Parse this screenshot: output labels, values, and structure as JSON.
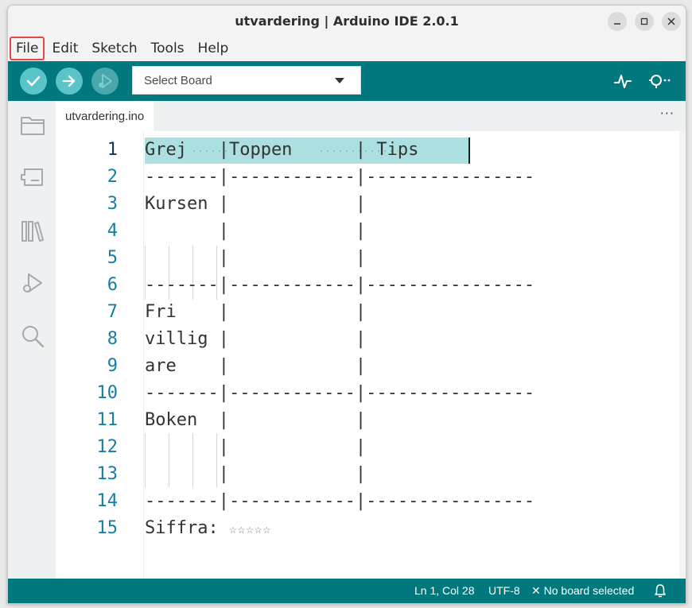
{
  "window": {
    "title": "utvardering | Arduino IDE 2.0.1",
    "controls": [
      "minimize-icon",
      "maximize-icon",
      "close-icon"
    ]
  },
  "menubar": {
    "items": [
      "File",
      "Edit",
      "Sketch",
      "Tools",
      "Help"
    ],
    "active": "File"
  },
  "toolbar": {
    "verify_icon": "checkmark-icon",
    "upload_icon": "arrow-right-icon",
    "debug_icon": "debug-icon",
    "board_select": "Select Board",
    "serial_plotter_icon": "pulse-icon",
    "serial_monitor_icon": "magnifier-dots-icon"
  },
  "sidebar": {
    "icons": [
      "folder-icon",
      "board-icon",
      "library-icon",
      "debug-icon",
      "search-icon"
    ]
  },
  "tabs": {
    "file": "utvardering.ino",
    "more": "···"
  },
  "editor": {
    "lines": [
      {
        "n": "1",
        "text": "Grej   |Toppen      | Tips"
      },
      {
        "n": "2",
        "text": "-------|------------|----------------"
      },
      {
        "n": "3",
        "text": "Kursen |            |"
      },
      {
        "n": "4",
        "text": "       |            |"
      },
      {
        "n": "5",
        "text": "       |            |"
      },
      {
        "n": "6",
        "text": "-------|------------|----------------"
      },
      {
        "n": "7",
        "text": "Fri    |            |"
      },
      {
        "n": "8",
        "text": "villig |            |"
      },
      {
        "n": "9",
        "text": "are    |            |"
      },
      {
        "n": "10",
        "text": "-------|------------|----------------"
      },
      {
        "n": "11",
        "text": "Boken  |            |"
      },
      {
        "n": "12",
        "text": "       |            |"
      },
      {
        "n": "13",
        "text": "       |            |"
      },
      {
        "n": "14",
        "text": "-------|------------|----------------"
      },
      {
        "n": "15",
        "text": "Siffra: "
      }
    ],
    "stars": "☆☆☆☆☆",
    "current_line": "1"
  },
  "statusbar": {
    "position": "Ln 1, Col 28",
    "encoding": "UTF-8",
    "board": "No board selected",
    "board_icon": "x-icon",
    "notification_icon": "bell-icon"
  },
  "colors": {
    "teal": "#00787d",
    "highlight": "#acdfe0",
    "line_number": "#157fa0",
    "active_menu_border": "#e04848"
  }
}
